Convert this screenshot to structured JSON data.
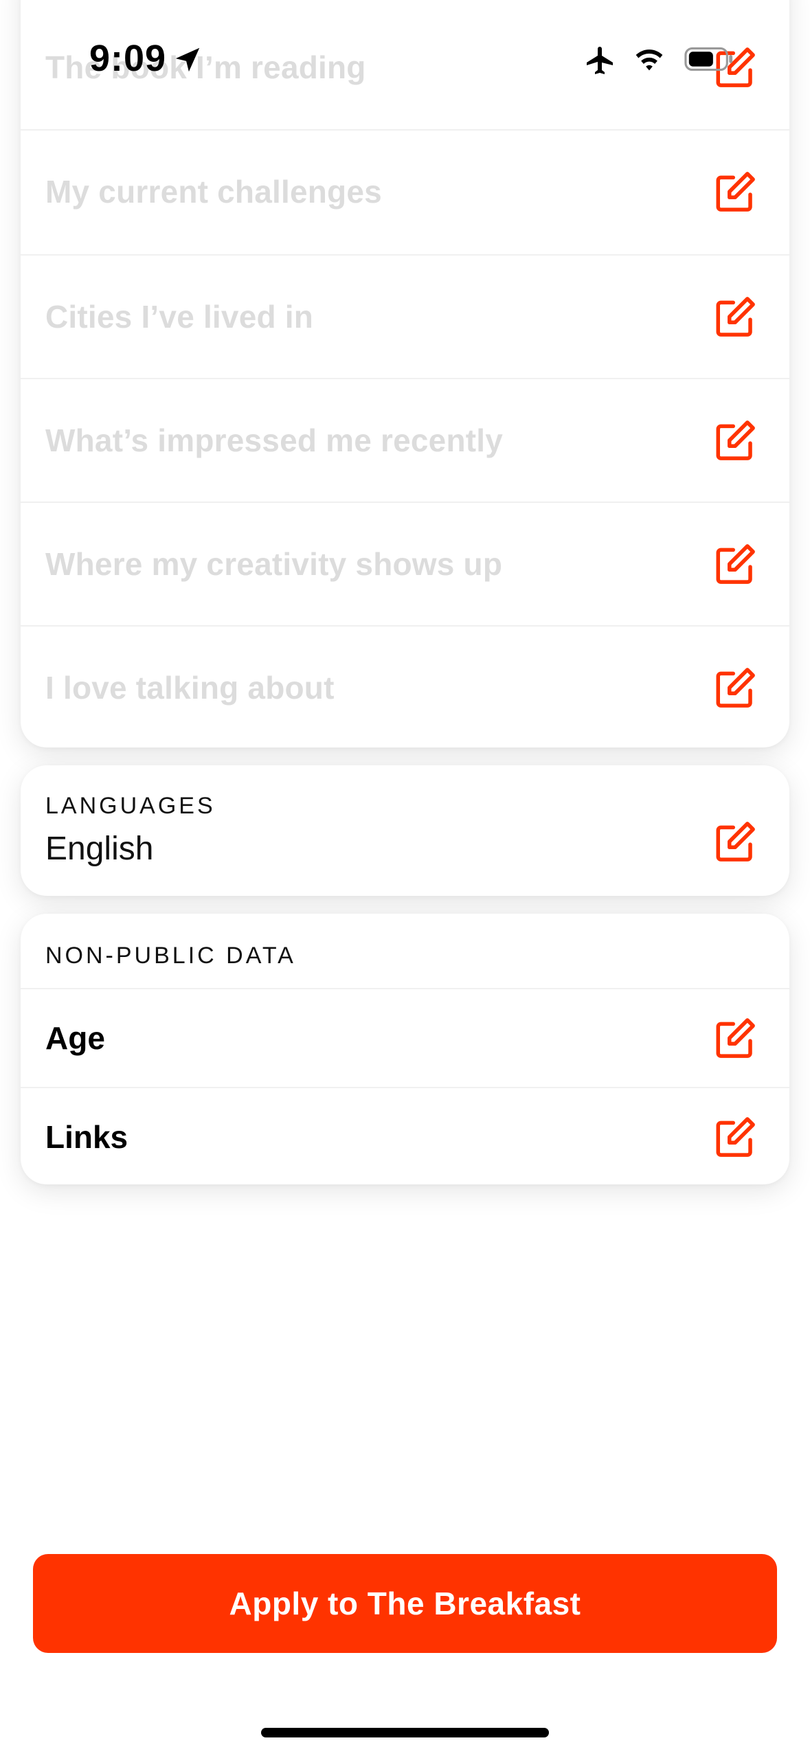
{
  "status_bar": {
    "time": "9:09"
  },
  "prompts": {
    "items": [
      {
        "label": "The book I’m reading"
      },
      {
        "label": "My current challenges"
      },
      {
        "label": "Cities I’ve lived in"
      },
      {
        "label": "What’s impressed me recently"
      },
      {
        "label": "Where my creativity shows up"
      },
      {
        "label": "I love talking about"
      }
    ]
  },
  "languages": {
    "heading": "LANGUAGES",
    "value": "English"
  },
  "non_public": {
    "heading": "NON-PUBLIC DATA",
    "items": [
      {
        "label": "Age"
      },
      {
        "label": "Links"
      }
    ]
  },
  "apply_button": {
    "label": "Apply to The Breakfast"
  },
  "colors": {
    "accent": "#ff3300",
    "placeholder_text": "#dcdcdc"
  },
  "icons": {
    "edit": "edit-icon",
    "location": "location-arrow-icon",
    "airplane": "airplane-mode-icon",
    "wifi": "wifi-icon",
    "battery": "battery-icon"
  }
}
